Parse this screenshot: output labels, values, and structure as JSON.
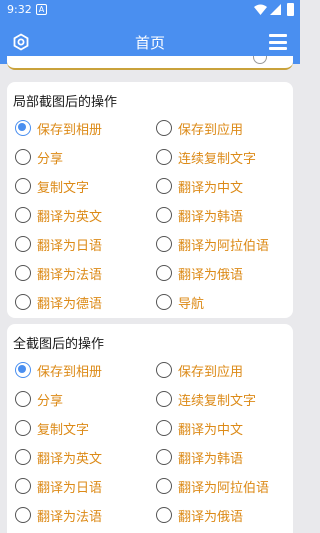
{
  "status_bar": {
    "time": "9:32",
    "notification_icon": "A"
  },
  "app_bar": {
    "title": "首页",
    "left_icon": "settings-hexagon-icon",
    "right_icon": "hamburger-menu-icon"
  },
  "colors": {
    "primary": "#4a8ff0",
    "option_text": "#dc8a17",
    "background": "#e9e9ec"
  },
  "partial_section": {
    "header": "局部截图后的操作",
    "selected": "保存到相册",
    "options": [
      "保存到相册",
      "保存到应用",
      "分享",
      "连续复制文字",
      "复制文字",
      "翻译为中文",
      "翻译为英文",
      "翻译为韩语",
      "翻译为日语",
      "翻译为阿拉伯语",
      "翻译为法语",
      "翻译为俄语",
      "翻译为德语",
      "导航"
    ]
  },
  "full_section": {
    "header": "全截图后的操作",
    "selected": "保存到相册",
    "options": [
      "保存到相册",
      "保存到应用",
      "分享",
      "连续复制文字",
      "复制文字",
      "翻译为中文",
      "翻译为英文",
      "翻译为韩语",
      "翻译为日语",
      "翻译为阿拉伯语",
      "翻译为法语",
      "翻译为俄语"
    ]
  }
}
